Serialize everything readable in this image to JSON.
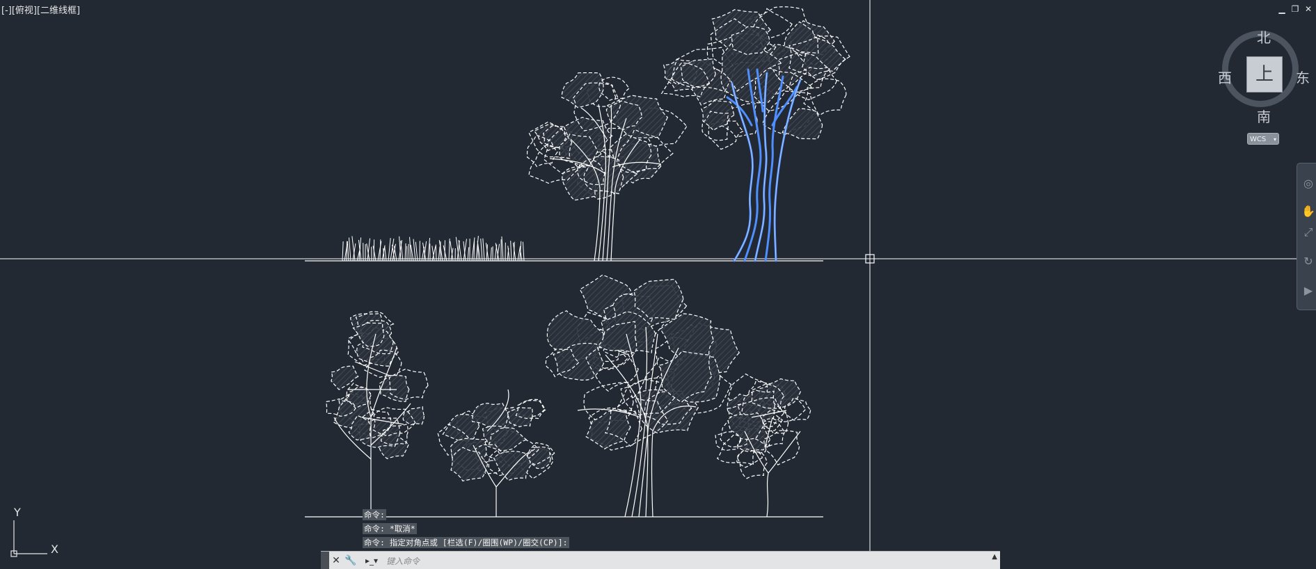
{
  "viewport": {
    "label": "[-][俯视][二维线框]",
    "controls": {
      "minimize": "▁",
      "restore": "❐",
      "close": "✕"
    }
  },
  "viewcube": {
    "face": "上",
    "north": "北",
    "south": "南",
    "east": "东",
    "west": "西",
    "wcs": "WCS"
  },
  "ucs": {
    "x": "X",
    "y": "Y"
  },
  "command": {
    "history": [
      "命令:",
      "命令: *取消*",
      "命令: 指定对角点或 [栏选(F)/圈围(WP)/圈交(CP)]:"
    ],
    "placeholder": "键入命令"
  },
  "colors": {
    "background": "#222933",
    "linework": "#ffffff",
    "selected": "#4f8fff",
    "hatch": "#3b4350"
  },
  "icons": [
    "close-icon",
    "wrench-icon",
    "command-prompt-icon",
    "chevron-up-icon",
    "steering-wheel-icon",
    "pan-icon",
    "zoom-icon",
    "orbit-icon",
    "showmotion-icon"
  ]
}
